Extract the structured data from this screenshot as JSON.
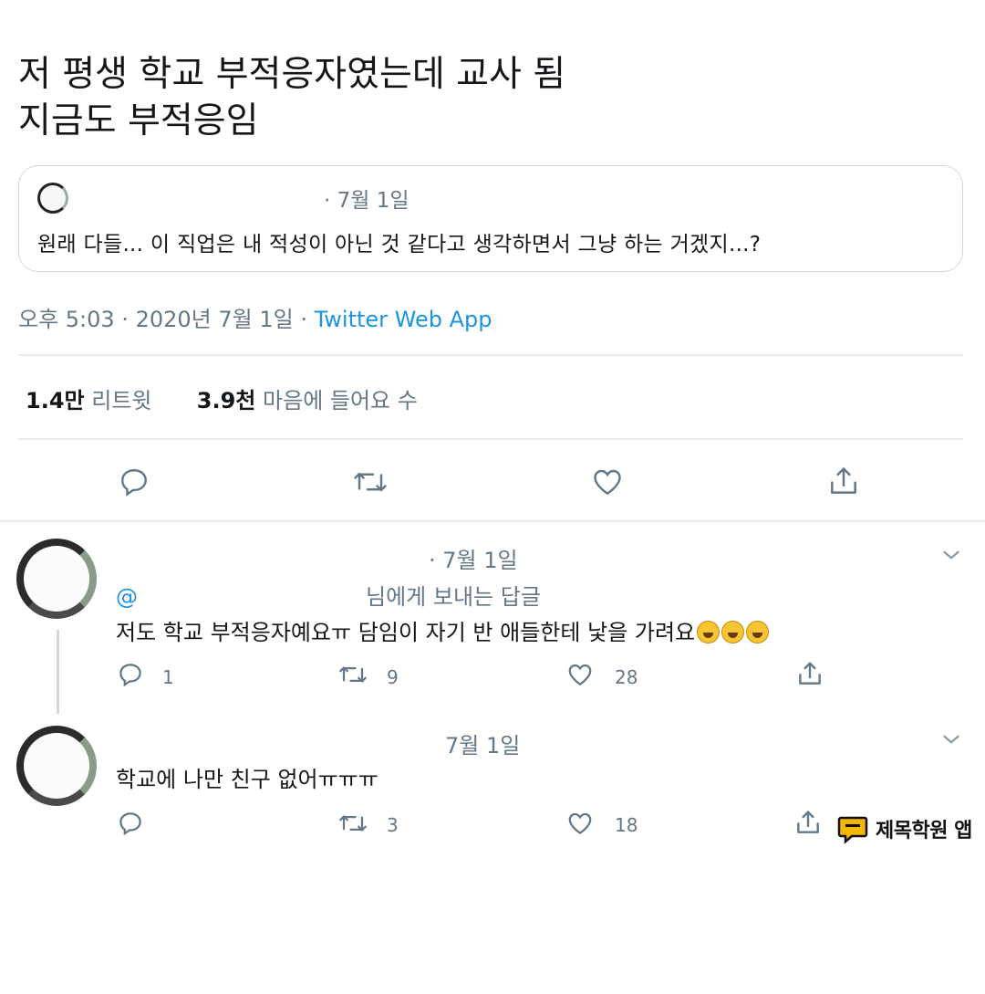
{
  "tweet": {
    "text_line1": "저 평생 학교 부적응자였는데 교사 됨",
    "text_line2": "지금도 부적응임",
    "quote": {
      "time": "· 7월 1일",
      "text": "원래 다들... 이 직업은 내 적성이 아닌 것 같다고 생각하면서 그냥 하는 거겠지...?"
    },
    "meta_time": "오후 5:03 · 2020년 7월 1일 · ",
    "meta_app": "Twitter Web App",
    "retweets_count": "1.4만",
    "retweets_label": "리트윗",
    "likes_count": "3.9천",
    "likes_label": "마음에 들어요 수"
  },
  "icons": [
    "reply-icon",
    "retweet-icon",
    "like-icon",
    "share-icon",
    "chevron-down-icon"
  ],
  "replies": [
    {
      "time": "· 7월 1일",
      "replying_at": "@",
      "replying_suffix": "님에게 보내는 답글",
      "text": "저도 학교 부적응자예요ㅠ 담임이 자기 반 애들한테 낯을 가려요",
      "emoji": "rolling-on-floor-laughing",
      "reply_count": "1",
      "retweet_count": "9",
      "like_count": "28"
    },
    {
      "time": "7월 1일",
      "text": "학교에 나만 친구 없어ㅠㅠㅠ",
      "reply_count": "",
      "retweet_count": "3",
      "like_count": "18"
    }
  ],
  "watermark": {
    "label": "제목학원 앱",
    "color": "#f5b800"
  }
}
